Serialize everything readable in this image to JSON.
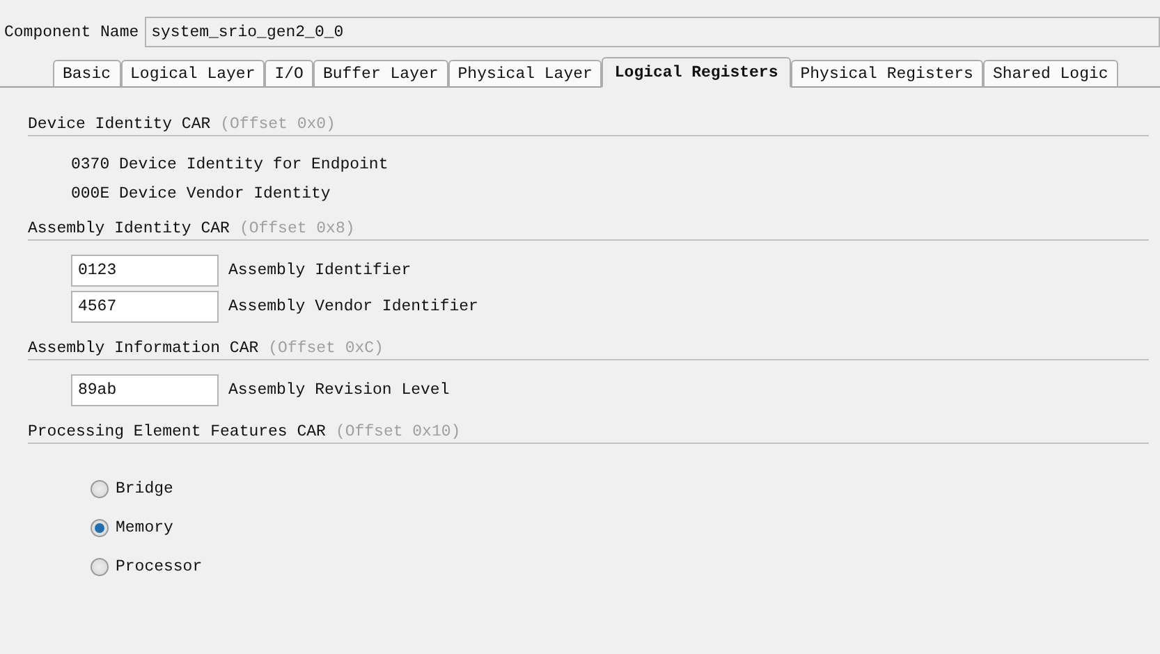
{
  "component_name": {
    "label": "Component Name",
    "value": "system_srio_gen2_0_0"
  },
  "tabs": [
    {
      "label": "Basic",
      "selected": false
    },
    {
      "label": "Logical Layer",
      "selected": false
    },
    {
      "label": "I/O",
      "selected": false
    },
    {
      "label": "Buffer Layer",
      "selected": false
    },
    {
      "label": "Physical Layer",
      "selected": false
    },
    {
      "label": "Logical Registers",
      "selected": true
    },
    {
      "label": "Physical Registers",
      "selected": false
    },
    {
      "label": "Shared Logic",
      "selected": false
    }
  ],
  "sections": [
    {
      "kind": "info",
      "title": "Device Identity CAR",
      "offset": "(Offset 0x0)",
      "items": [
        {
          "text": "0370 Device Identity for Endpoint"
        },
        {
          "text": "000E Device Vendor Identity"
        }
      ]
    },
    {
      "kind": "fields",
      "title": "Assembly Identity CAR",
      "offset": "(Offset 0x8)",
      "items": [
        {
          "value": "0123",
          "label": "Assembly Identifier"
        },
        {
          "value": "4567",
          "label": "Assembly Vendor Identifier"
        }
      ]
    },
    {
      "kind": "fields",
      "title": "Assembly Information CAR",
      "offset": "(Offset 0xC)",
      "items": [
        {
          "value": "89ab",
          "label": "Assembly Revision Level"
        }
      ]
    },
    {
      "kind": "radios",
      "title": "Processing Element Features CAR",
      "offset": "(Offset 0x10)",
      "items": [
        {
          "label": "Bridge",
          "selected": false
        },
        {
          "label": "Memory",
          "selected": true
        },
        {
          "label": "Processor",
          "selected": false
        }
      ]
    }
  ]
}
